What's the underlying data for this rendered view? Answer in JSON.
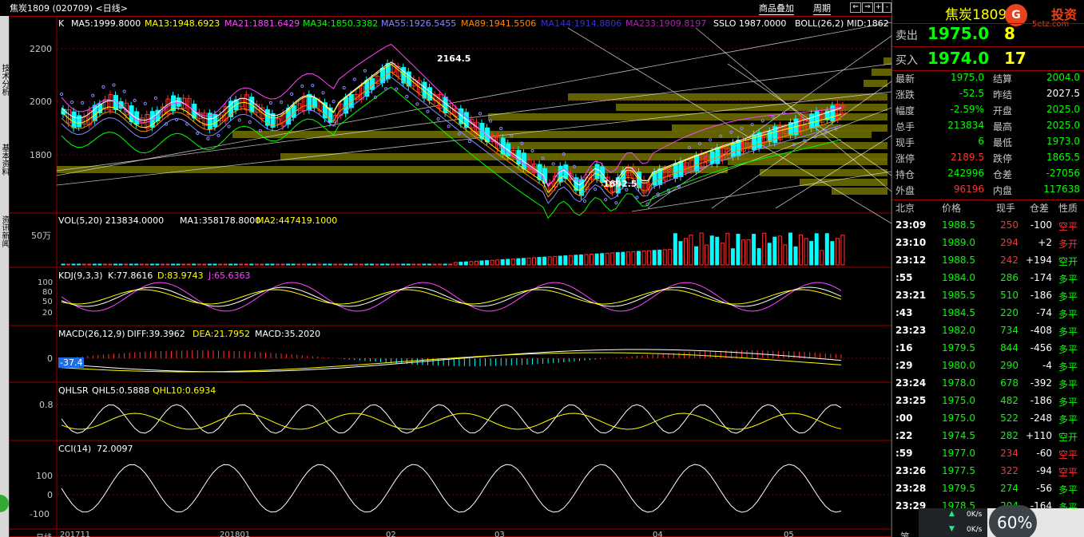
{
  "window": {
    "title": "焦炭1809 (020709) <日线>",
    "btn_overlay": "商品叠加",
    "btn_period": "周期",
    "nav_icons": [
      "arrow-left-icon",
      "arrow-right-icon",
      "plus-icon",
      "minus-icon"
    ]
  },
  "left_tabs": [
    "技术分析",
    "基本资料",
    "资讯新闻"
  ],
  "main_indicator": {
    "k_label": "K",
    "ma5": "MA5:1999.8000",
    "ma13": "MA13:1948.6923",
    "ma21": "MA21:1881.6429",
    "ma34": "MA34:1850.3382",
    "ma55": "MA55:1926.5455",
    "ma89": "MA89:1941.5506",
    "ma144": "MA144:1914.8806",
    "ma233": "MA233:1909.8197",
    "sslo": "SSLO 1987.0000",
    "boll": "BOLL(26,2) MID:1862"
  },
  "price_axis": [
    "2200",
    "2000",
    "1800"
  ],
  "markers": {
    "high": "2164.5",
    "low": "1692.5"
  },
  "vol_panel": {
    "label": "VOL(5,20) 213834.0000",
    "ma1": "MA1:358178.8000",
    "ma2": "MA2:447419.1000",
    "axis": "50万"
  },
  "kdj_panel": {
    "label": "KDJ(9,3,3)",
    "k": "K:77.8616",
    "d": "D:83.9743",
    "j": "J:65.6363",
    "axis": [
      "100",
      "80",
      "50",
      "20"
    ]
  },
  "macd_panel": {
    "label": "MACD(26,12,9)",
    "diff": "DIFF:39.3962",
    "dea": "DEA:21.7952",
    "macd": "MACD:35.2020",
    "axis": "0",
    "badge": "-37.4"
  },
  "qhlsr_panel": {
    "label": "QHLSR",
    "q5": "QHL5:0.5888",
    "q10": "QHL10:0.6934",
    "axis": "0.8"
  },
  "cci_panel": {
    "label": "CCI(14)",
    "value": "72.0097",
    "axis": [
      "100",
      "0",
      "-100"
    ]
  },
  "x_axis": {
    "label": "日线",
    "dates": [
      "201711",
      "201801",
      "02",
      "03",
      "04",
      "05"
    ]
  },
  "quote": {
    "title": "焦炭1809(",
    "sell_label": "卖出",
    "sell_price": "1975.0",
    "sell_vol": "8",
    "buy_label": "买入",
    "buy_price": "1974.0",
    "buy_vol": "17",
    "stats": [
      [
        "最新",
        "1975.0",
        "结算",
        "2004.0"
      ],
      [
        "涨跌",
        "-52.5",
        "昨结",
        "2027.5"
      ],
      [
        "幅度",
        "-2.59%",
        "开盘",
        "2025.0"
      ],
      [
        "总手",
        "213834",
        "最高",
        "2025.0"
      ],
      [
        "现手",
        "6",
        "最低",
        "1973.0"
      ],
      [
        "涨停",
        "2189.5",
        "跌停",
        "1865.5"
      ],
      [
        "持仓",
        "242996",
        "仓差",
        "-27056"
      ],
      [
        "外盘",
        "96196",
        "内盘",
        "117638"
      ]
    ],
    "tick_header": [
      "北京",
      "价格",
      "现手",
      "仓差",
      "性质"
    ],
    "ticks": [
      [
        "23:09",
        "1988.5",
        "250",
        "-100",
        "空平"
      ],
      [
        "23:10",
        "1989.0",
        "294",
        "+2",
        "多开"
      ],
      [
        "23:12",
        "1988.5",
        "242",
        "+194",
        "空开"
      ],
      [
        ":55",
        "1984.0",
        "286",
        "-174",
        "多平"
      ],
      [
        "23:21",
        "1985.5",
        "510",
        "-186",
        "多平"
      ],
      [
        ":43",
        "1984.5",
        "220",
        "-74",
        "多平"
      ],
      [
        "23:23",
        "1982.0",
        "734",
        "-408",
        "多平"
      ],
      [
        ":16",
        "1979.5",
        "844",
        "-456",
        "多平"
      ],
      [
        ":29",
        "1980.0",
        "290",
        "-4",
        "多平"
      ],
      [
        "23:24",
        "1978.0",
        "678",
        "-392",
        "多平"
      ],
      [
        "23:25",
        "1975.0",
        "482",
        "-186",
        "多平"
      ],
      [
        ":00",
        "1975.0",
        "522",
        "-248",
        "多平"
      ],
      [
        ":22",
        "1974.5",
        "282",
        "+110",
        "空开"
      ],
      [
        ":59",
        "1977.0",
        "234",
        "-60",
        "空平"
      ],
      [
        "23:26",
        "1977.5",
        "322",
        "-94",
        "空平"
      ],
      [
        "23:28",
        "1979.5",
        "274",
        "-56",
        "多平"
      ],
      [
        "23:29",
        "1978.5",
        "204",
        "-164",
        "多平"
      ]
    ],
    "footer_char": "笔"
  },
  "logo": {
    "brand": "投资",
    "site": "5etz.com"
  },
  "speed": {
    "up": "0K/s",
    "down": "0K/s",
    "percent": "60%"
  },
  "colors": {
    "up": "#ff3232",
    "down": "#00ffff",
    "label_white": "#ffffff",
    "panel_border": "#a00000",
    "accent_yellow": "#ffff00",
    "green": "#00ff00"
  }
}
